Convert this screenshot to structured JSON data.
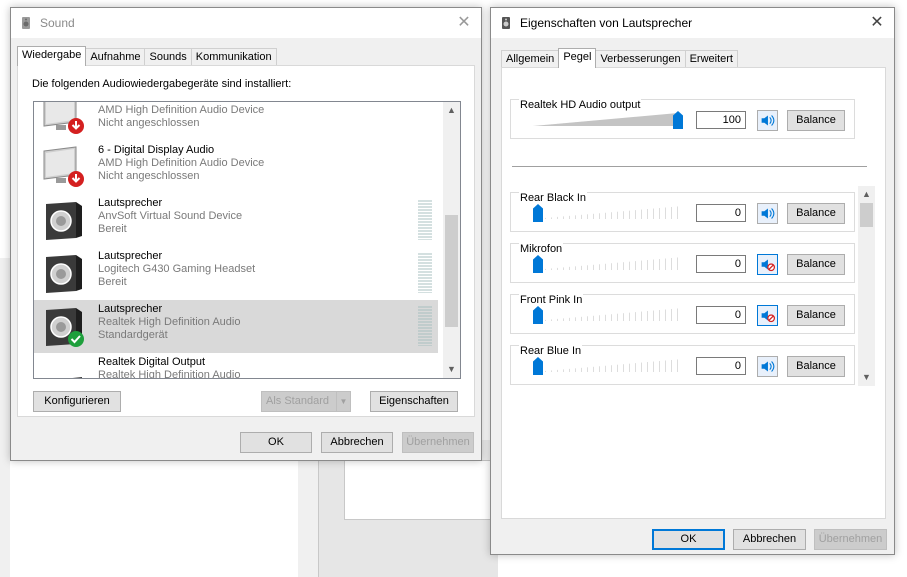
{
  "sound_window": {
    "title": "Sound",
    "tabs": [
      "Wiedergabe",
      "Aufnahme",
      "Sounds",
      "Kommunikation"
    ],
    "active_tab": 0,
    "instruction": "Die folgenden Audiowiedergabegeräte sind installiert:",
    "devices": [
      {
        "name": "",
        "desc": "AMD High Definition Audio Device",
        "status": "Nicht angeschlossen",
        "icon": "monitor-disconnected-icon",
        "selected": false
      },
      {
        "name": "6 - Digital Display Audio",
        "desc": "AMD High Definition Audio Device",
        "status": "Nicht angeschlossen",
        "icon": "monitor-disconnected-icon",
        "selected": false
      },
      {
        "name": "Lautsprecher",
        "desc": "AnvSoft Virtual Sound Device",
        "status": "Bereit",
        "icon": "speaker-icon",
        "selected": false
      },
      {
        "name": "Lautsprecher",
        "desc": "Logitech G430 Gaming Headset",
        "status": "Bereit",
        "icon": "speaker-icon",
        "selected": false
      },
      {
        "name": "Lautsprecher",
        "desc": "Realtek High Definition Audio",
        "status": "Standardgerät",
        "icon": "speaker-default-icon",
        "selected": true
      },
      {
        "name": "Realtek Digital Output",
        "desc": "Realtek High Definition Audio",
        "status": "",
        "icon": "digital-output-icon",
        "selected": false
      }
    ],
    "buttons": {
      "configure": "Konfigurieren",
      "set_default": "Als Standard",
      "properties": "Eigenschaften",
      "ok": "OK",
      "cancel": "Abbrechen",
      "apply": "Übernehmen"
    }
  },
  "props_window": {
    "title": "Eigenschaften von Lautsprecher",
    "tabs": [
      "Allgemein",
      "Pegel",
      "Verbesserungen",
      "Erweitert"
    ],
    "active_tab": 1,
    "master": {
      "label": "Realtek HD Audio output",
      "value": "100",
      "level": 100,
      "muted": false,
      "balance": "Balance"
    },
    "channels": [
      {
        "label": "Rear Black In",
        "value": "0",
        "level": 0,
        "muted": false,
        "balance": "Balance"
      },
      {
        "label": "Mikrofon",
        "value": "0",
        "level": 0,
        "muted": true,
        "balance": "Balance"
      },
      {
        "label": "Front Pink In",
        "value": "0",
        "level": 0,
        "muted": true,
        "balance": "Balance"
      },
      {
        "label": "Rear Blue In",
        "value": "0",
        "level": 0,
        "muted": false,
        "balance": "Balance"
      }
    ],
    "buttons": {
      "ok": "OK",
      "cancel": "Abbrechen",
      "apply": "Übernehmen"
    }
  },
  "colors": {
    "accent": "#0078d7",
    "check_green": "#1e9f3c",
    "warn_red": "#d42020"
  }
}
